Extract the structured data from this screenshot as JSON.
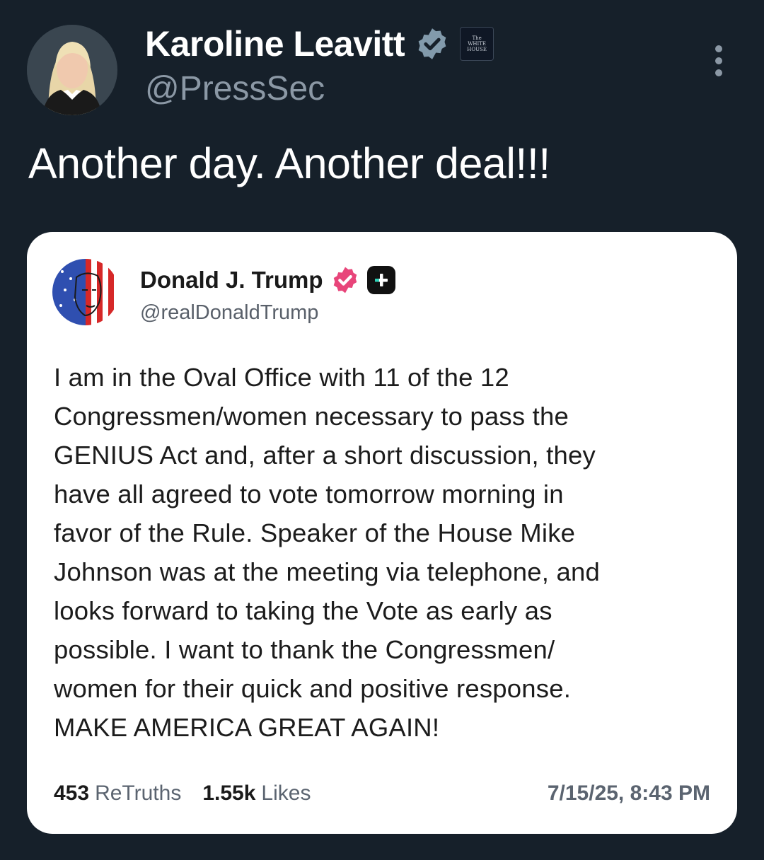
{
  "tweet": {
    "author": {
      "display_name": "Karoline Leavitt",
      "handle": "@PressSec",
      "verified_badge": "grey-verified-check",
      "affiliate_badge": {
        "line1": "The",
        "line2": "WHITE",
        "line3": "HOUSE"
      }
    },
    "more_menu_icon": "more-vertical-icon",
    "text": "Another day. Another deal!!!"
  },
  "quoted_post": {
    "author": {
      "display_name": "Donald J. Trump",
      "handle": "@realDonaldTrump",
      "verified_badge": "pink-verified-check",
      "platform_badge": "plus-icon"
    },
    "body_lines": [
      "I am in the Oval Office with 11 of the 12",
      "Congressmen/women necessary to pass the",
      "GENIUS Act and, after a short discussion, they",
      "have all agreed to vote tomorrow morning in",
      "favor of the Rule. Speaker of the House Mike",
      "Johnson was at the meeting via telephone, and",
      "looks forward to taking the Vote as early as",
      "possible. I want to thank the Congressmen/",
      "women for their quick and positive response.",
      "MAKE AMERICA GREAT AGAIN!"
    ],
    "stats": {
      "retruths_count": "453",
      "retruths_label": "ReTruths",
      "likes_count": "1.55k",
      "likes_label": "Likes"
    },
    "timestamp": "7/15/25, 8:43 PM"
  },
  "colors": {
    "background": "#16202a",
    "card": "#ffffff",
    "primary_text": "#ffffff",
    "secondary_text": "#8b98a5",
    "verified_pink": "#e8457a",
    "verified_grey": "#829aab"
  }
}
